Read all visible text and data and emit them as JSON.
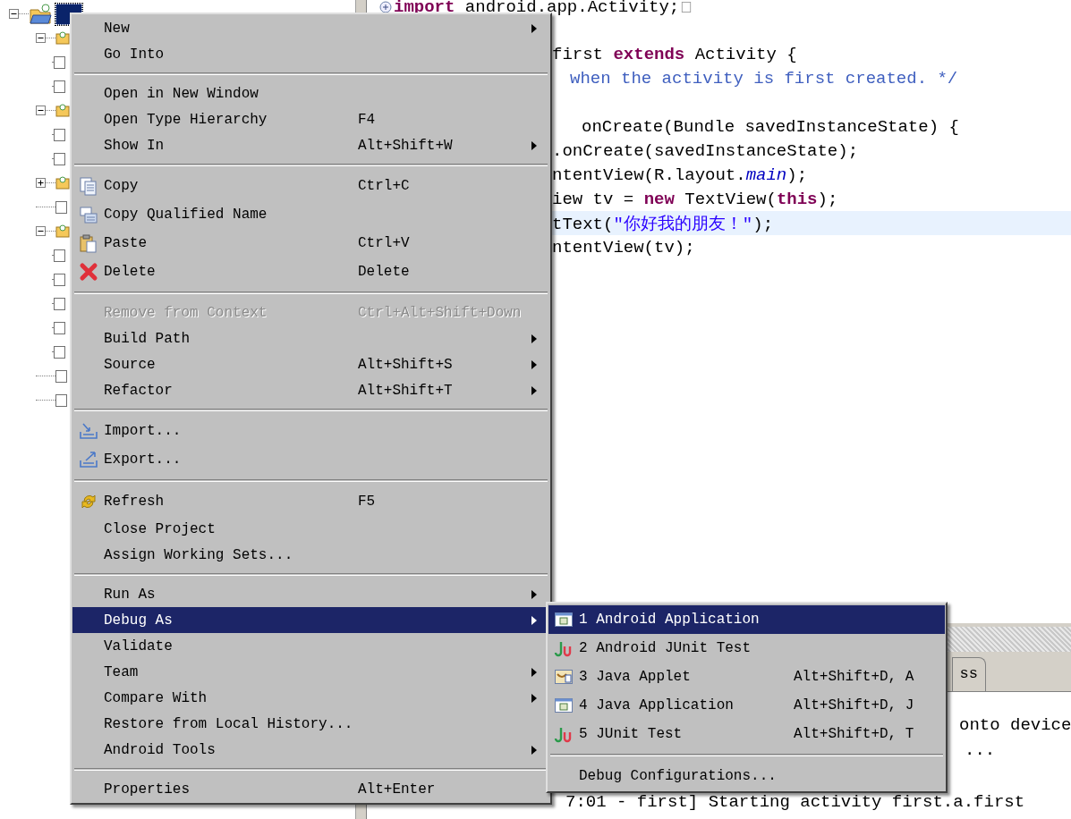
{
  "project_tree": {
    "root": {
      "kind": "project",
      "selected": true,
      "expanded": true,
      "children": [
        {
          "kind": "package",
          "expanded": true,
          "children": [
            {
              "kind": "file"
            },
            {
              "kind": "file"
            }
          ]
        },
        {
          "kind": "package",
          "expanded": true,
          "children": [
            {
              "kind": "file"
            },
            {
              "kind": "file"
            }
          ]
        },
        {
          "kind": "package",
          "expanded": false
        },
        {
          "kind": "file"
        },
        {
          "kind": "package",
          "expanded": true,
          "children": [
            {
              "kind": "file"
            },
            {
              "kind": "file"
            },
            {
              "kind": "file"
            },
            {
              "kind": "file"
            },
            {
              "kind": "file"
            }
          ]
        },
        {
          "kind": "file"
        },
        {
          "kind": "file"
        }
      ]
    }
  },
  "editor": {
    "lines": [
      {
        "current": false,
        "tokens": [
          {
            "kind": "keyword",
            "text": "import"
          },
          {
            "kind": "plain",
            "text": " android.app.Activity;"
          }
        ]
      },
      {
        "current": false,
        "tokens": [
          {
            "kind": "plain",
            "text": "first "
          },
          {
            "kind": "keyword",
            "text": "extends"
          },
          {
            "kind": "plain",
            "text": " Activity {"
          }
        ]
      },
      {
        "current": false,
        "tokens": [
          {
            "kind": "comment",
            "text": "when the activity is first created. */"
          }
        ]
      },
      {
        "current": false,
        "tokens": [
          {
            "kind": "plain",
            "text": "onCreate(Bundle savedInstanceState) {"
          }
        ]
      },
      {
        "current": false,
        "tokens": [
          {
            "kind": "plain",
            "text": ".onCreate(savedInstanceState);"
          }
        ]
      },
      {
        "current": false,
        "tokens": [
          {
            "kind": "plain",
            "text": "ntentView(R.layout."
          },
          {
            "kind": "field",
            "text": "main"
          },
          {
            "kind": "plain",
            "text": ");"
          }
        ]
      },
      {
        "current": false,
        "tokens": [
          {
            "kind": "plain",
            "text": "iew tv = "
          },
          {
            "kind": "keyword",
            "text": "new"
          },
          {
            "kind": "plain",
            "text": " TextView("
          },
          {
            "kind": "keyword",
            "text": "this"
          },
          {
            "kind": "plain",
            "text": ");"
          }
        ]
      },
      {
        "current": true,
        "tokens": [
          {
            "kind": "plain",
            "text": "tText("
          },
          {
            "kind": "string",
            "text": "\"你好我的朋友！\""
          },
          {
            "kind": "plain",
            "text": ");"
          }
        ]
      },
      {
        "current": false,
        "tokens": [
          {
            "kind": "plain",
            "text": "ntentView(tv);"
          }
        ]
      }
    ]
  },
  "bottom_panel": {
    "tabs": [
      {
        "label": "ss"
      }
    ],
    "console_lines": [
      "onto device",
      "...",
      "7:01 - first] Starting activity first.a.first"
    ]
  },
  "main_menu": {
    "items": [
      {
        "kind": "item",
        "label": "New",
        "has_submenu": true,
        "selected": false,
        "disabled": false
      },
      {
        "kind": "item",
        "label": "Go Into",
        "has_submenu": false,
        "selected": false,
        "disabled": false
      },
      {
        "kind": "separator"
      },
      {
        "kind": "item",
        "label": "Open in New Window",
        "has_submenu": false,
        "selected": false,
        "disabled": false
      },
      {
        "kind": "item",
        "label": "Open Type Hierarchy",
        "shortcut": "F4",
        "has_submenu": false,
        "selected": false,
        "disabled": false
      },
      {
        "kind": "item",
        "label": "Show In",
        "shortcut": "Alt+Shift+W",
        "has_submenu": true,
        "selected": false,
        "disabled": false
      },
      {
        "kind": "separator"
      },
      {
        "kind": "item",
        "label": "Copy",
        "shortcut": "Ctrl+C",
        "has_submenu": false,
        "selected": false,
        "disabled": false
      },
      {
        "kind": "item",
        "label": "Copy Qualified Name",
        "has_submenu": false,
        "selected": false,
        "disabled": false
      },
      {
        "kind": "item",
        "label": "Paste",
        "shortcut": "Ctrl+V",
        "has_submenu": false,
        "selected": false,
        "disabled": false
      },
      {
        "kind": "item",
        "label": "Delete",
        "shortcut": "Delete",
        "has_submenu": false,
        "selected": false,
        "disabled": false
      },
      {
        "kind": "separator"
      },
      {
        "kind": "item",
        "label": "Remove from Context",
        "shortcut": "Ctrl+Alt+Shift+Down",
        "has_submenu": false,
        "selected": false,
        "disabled": true
      },
      {
        "kind": "item",
        "label": "Build Path",
        "has_submenu": true,
        "selected": false,
        "disabled": false
      },
      {
        "kind": "item",
        "label": "Source",
        "shortcut": "Alt+Shift+S",
        "has_submenu": true,
        "selected": false,
        "disabled": false
      },
      {
        "kind": "item",
        "label": "Refactor",
        "shortcut": "Alt+Shift+T",
        "has_submenu": true,
        "selected": false,
        "disabled": false
      },
      {
        "kind": "separator"
      },
      {
        "kind": "item",
        "label": "Import...",
        "has_submenu": false,
        "selected": false,
        "disabled": false
      },
      {
        "kind": "item",
        "label": "Export...",
        "has_submenu": false,
        "selected": false,
        "disabled": false
      },
      {
        "kind": "separator"
      },
      {
        "kind": "item",
        "label": "Refresh",
        "shortcut": "F5",
        "has_submenu": false,
        "selected": false,
        "disabled": false
      },
      {
        "kind": "item",
        "label": "Close Project",
        "has_submenu": false,
        "selected": false,
        "disabled": false
      },
      {
        "kind": "item",
        "label": "Assign Working Sets...",
        "has_submenu": false,
        "selected": false,
        "disabled": false
      },
      {
        "kind": "separator"
      },
      {
        "kind": "item",
        "label": "Run As",
        "has_submenu": true,
        "selected": false,
        "disabled": false
      },
      {
        "kind": "item",
        "label": "Debug As",
        "has_submenu": true,
        "selected": true,
        "disabled": false
      },
      {
        "kind": "item",
        "label": "Validate",
        "has_submenu": false,
        "selected": false,
        "disabled": false
      },
      {
        "kind": "item",
        "label": "Team",
        "has_submenu": true,
        "selected": false,
        "disabled": false
      },
      {
        "kind": "item",
        "label": "Compare With",
        "has_submenu": true,
        "selected": false,
        "disabled": false
      },
      {
        "kind": "item",
        "label": "Restore from Local History...",
        "has_submenu": false,
        "selected": false,
        "disabled": false
      },
      {
        "kind": "item",
        "label": "Android Tools",
        "has_submenu": true,
        "selected": false,
        "disabled": false
      },
      {
        "kind": "separator"
      },
      {
        "kind": "item",
        "label": "Properties",
        "shortcut": "Alt+Enter",
        "has_submenu": false,
        "selected": false,
        "disabled": false
      }
    ]
  },
  "debug_as_submenu": {
    "items": [
      {
        "kind": "item",
        "label": "1 Android Application",
        "selected": true
      },
      {
        "kind": "item",
        "label": "2 Android JUnit Test",
        "selected": false
      },
      {
        "kind": "item",
        "label": "3 Java Applet",
        "shortcut": "Alt+Shift+D, A",
        "selected": false
      },
      {
        "kind": "item",
        "label": "4 Java Application",
        "shortcut": "Alt+Shift+D, J",
        "selected": false
      },
      {
        "kind": "item",
        "label": "5 JUnit Test",
        "shortcut": "Alt+Shift+D, T",
        "selected": false
      },
      {
        "kind": "separator"
      },
      {
        "kind": "item",
        "label": "Debug Configurations...",
        "selected": false
      }
    ]
  }
}
